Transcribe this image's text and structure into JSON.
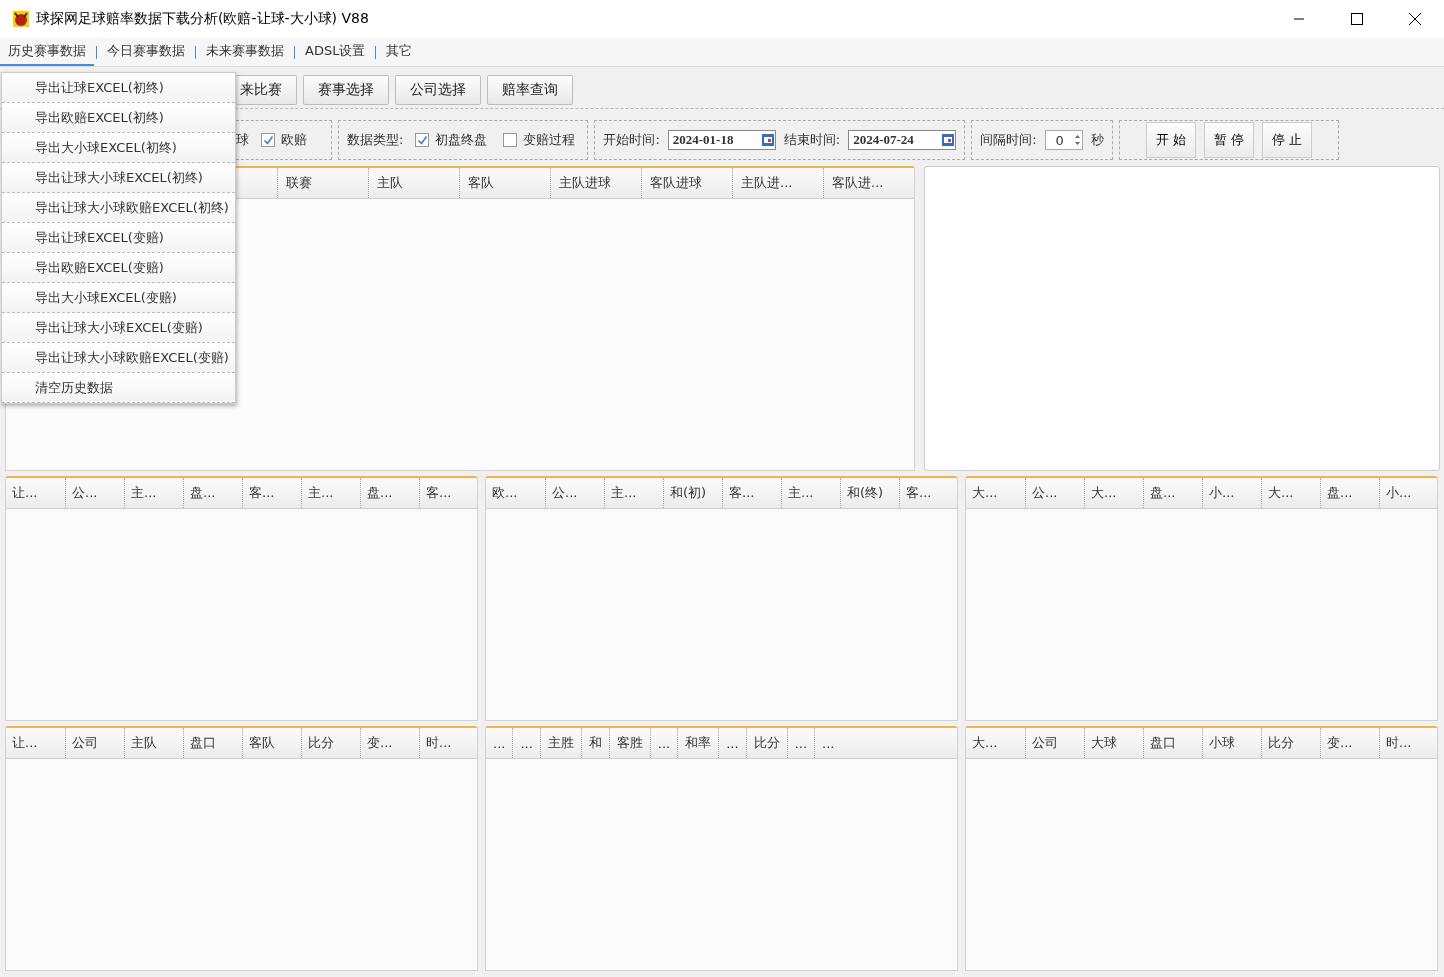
{
  "window": {
    "title": "球探网足球赔率数据下载分析(欧赔-让球-大小球) V88"
  },
  "menu_tabs": [
    {
      "label": "历史赛事数据",
      "selected": true
    },
    {
      "label": "今日赛事数据",
      "selected": false
    },
    {
      "label": "未来赛事数据",
      "selected": false
    },
    {
      "label": "ADSL设置",
      "selected": false
    },
    {
      "label": "其它",
      "selected": false
    }
  ],
  "dropdown_menu": {
    "items": [
      "导出让球EXCEL(初终)",
      "导出欧赔EXCEL(初终)",
      "导出大小球EXCEL(初终)",
      "导出让球大小球EXCEL(初终)",
      "导出让球大小球欧赔EXCEL(初终)",
      "导出让球EXCEL(变赔)",
      "导出欧赔EXCEL(变赔)",
      "导出大小球EXCEL(变赔)",
      "导出让球大小球EXCEL(变赔)",
      "导出让球大小球欧赔EXCEL(变赔)",
      "清空历史数据"
    ]
  },
  "toolbar": {
    "buttons": [
      "来比赛",
      "赛事选择",
      "公司选择",
      "赔率查询"
    ]
  },
  "filters": {
    "cut_label": "球",
    "odds_checkbox": {
      "label": "欧赔",
      "checked": true
    },
    "data_type": {
      "label": "数据类型:",
      "options": [
        {
          "label": "初盘终盘",
          "checked": true
        },
        {
          "label": "变赔过程",
          "checked": false
        }
      ]
    },
    "start_time": {
      "label": "开始时间:",
      "value": "2024-01-18"
    },
    "end_time": {
      "label": "结束时间:",
      "value": "2024-07-24"
    },
    "interval": {
      "label": "间隔时间:",
      "value": "0",
      "unit": "秒"
    },
    "actions": [
      "开 始",
      "暂 停",
      "停 止"
    ]
  },
  "main_grid": {
    "columns": [
      "联赛",
      "主队",
      "客队",
      "主队进球",
      "客队进球",
      "主队进...",
      "客队进..."
    ]
  },
  "grids": [
    {
      "columns": [
        "让...",
        "公...",
        "主...",
        "盘...",
        "客...",
        "主...",
        "盘...",
        "客..."
      ]
    },
    {
      "columns": [
        "欧...",
        "公...",
        "主...",
        "和(初)",
        "客...",
        "主...",
        "和(终)",
        "客..."
      ]
    },
    {
      "columns": [
        "大...",
        "公...",
        "大...",
        "盘...",
        "小...",
        "大...",
        "盘...",
        "小..."
      ]
    },
    {
      "columns": [
        "让...",
        "公司",
        "主队",
        "盘口",
        "客队",
        "比分",
        "变...",
        "时..."
      ]
    },
    {
      "columns": [
        "...",
        "...",
        "主胜",
        "和",
        "客胜",
        "...",
        "和率",
        "...",
        "比分",
        "...",
        "..."
      ]
    },
    {
      "columns": [
        "大...",
        "公司",
        "大球",
        "盘口",
        "小球",
        "比分",
        "变...",
        "时..."
      ]
    }
  ]
}
